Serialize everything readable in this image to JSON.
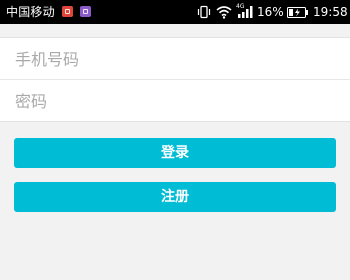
{
  "status_bar": {
    "carrier": "中国移动",
    "network_type": "4G",
    "battery_percent": "16%",
    "time": "19:58",
    "notification_icons": [
      "app-notification-red-icon",
      "app-notification-purple-icon"
    ],
    "icons": [
      "vibrate-icon",
      "wifi-icon",
      "signal-icon",
      "battery-charging-icon"
    ]
  },
  "form": {
    "phone_placeholder": "手机号码",
    "phone_value": "",
    "password_placeholder": "密码",
    "password_value": ""
  },
  "buttons": {
    "login_label": "登录",
    "register_label": "注册"
  },
  "colors": {
    "status_bar_bg": "#000000",
    "background": "#f2f2f2",
    "form_bg": "#ffffff",
    "placeholder": "#a9a9a9",
    "accent": "#00bcd4",
    "button_text": "#ffffff"
  }
}
